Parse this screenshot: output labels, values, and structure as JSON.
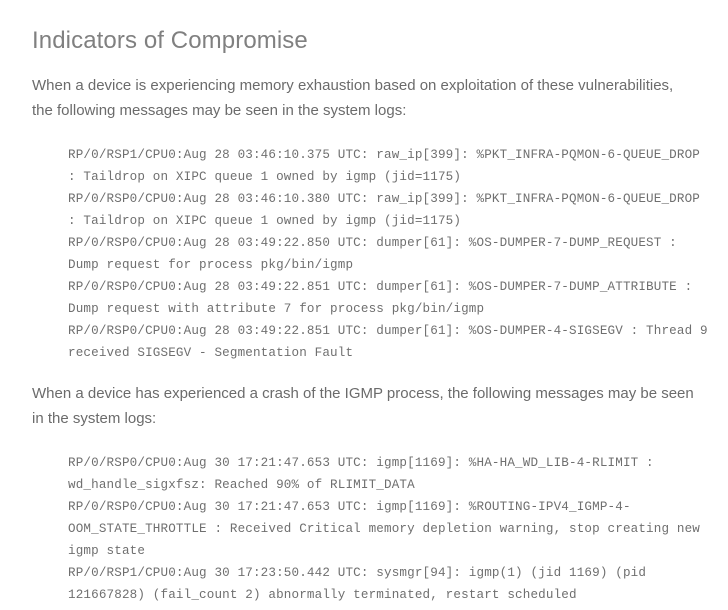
{
  "document": {
    "section_title": "Indicators of Compromise",
    "paragraphs": [
      "When a device is experiencing memory exhaustion based on exploitation of these vulnerabilities, the following messages may be seen in the system logs:",
      "When a device has experienced a crash of the IGMP process, the following messages may be seen in the system logs:"
    ],
    "code_blocks": [
      {
        "name": "memory-exhaustion-logs",
        "lines": [
          "RP/0/RSP1/CPU0:Aug 28 03:46:10.375 UTC: raw_ip[399]: %PKT_INFRA-PQMON-6-QUEUE_DROP",
          ": Taildrop on XIPC queue 1 owned by igmp (jid=1175)",
          "RP/0/RSP0/CPU0:Aug 28 03:46:10.380 UTC: raw_ip[399]: %PKT_INFRA-PQMON-6-QUEUE_DROP",
          ": Taildrop on XIPC queue 1 owned by igmp (jid=1175)",
          "RP/0/RSP0/CPU0:Aug 28 03:49:22.850 UTC: dumper[61]: %OS-DUMPER-7-DUMP_REQUEST :",
          "Dump request for process pkg/bin/igmp",
          "RP/0/RSP0/CPU0:Aug 28 03:49:22.851 UTC: dumper[61]: %OS-DUMPER-7-DUMP_ATTRIBUTE :",
          "Dump request with attribute 7 for process pkg/bin/igmp",
          "RP/0/RSP0/CPU0:Aug 28 03:49:22.851 UTC: dumper[61]: %OS-DUMPER-4-SIGSEGV : Thread 9",
          "received SIGSEGV - Segmentation Fault"
        ]
      },
      {
        "name": "igmp-crash-logs",
        "lines": [
          "RP/0/RSP0/CPU0:Aug 30 17:21:47.653 UTC: igmp[1169]: %HA-HA_WD_LIB-4-RLIMIT :",
          "wd_handle_sigxfsz: Reached 90% of RLIMIT_DATA",
          "RP/0/RSP0/CPU0:Aug 30 17:21:47.653 UTC: igmp[1169]: %ROUTING-IPV4_IGMP-4-",
          "OOM_STATE_THROTTLE : Received Critical memory depletion warning, stop creating new",
          "igmp state",
          "RP/0/RSP1/CPU0:Aug 30 17:23:50.442 UTC: sysmgr[94]: igmp(1) (jid 1169) (pid",
          "121667828) (fail_count 2) abnormally terminated, restart scheduled"
        ]
      }
    ]
  },
  "colors": {
    "page_background": "#ffffff",
    "heading_text": "#808080",
    "body_text": "#6b6b6b",
    "code_text": "#6f6f6f"
  }
}
